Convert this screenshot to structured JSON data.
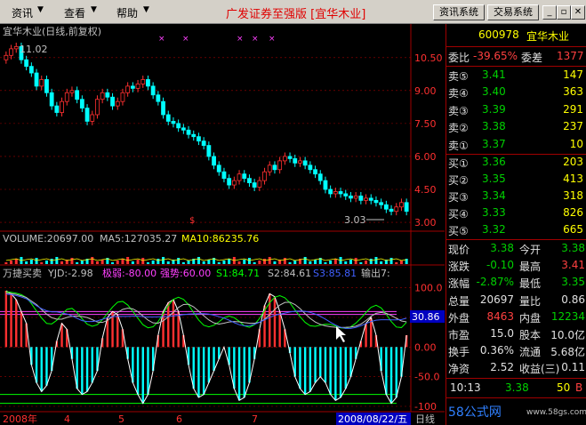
{
  "menu": {
    "items": [
      "资讯",
      "查看",
      "帮助"
    ],
    "title": "广发证券至强版 [宜华木业]",
    "buttons": [
      "资讯系统",
      "交易系统"
    ]
  },
  "chart_header": {
    "title": "宜华木业(日线,前复权)",
    "high_label": "11.02",
    "low_label": "3.03"
  },
  "chart_data": [
    {
      "type": "candlestick",
      "title": "宜华木业(日线,前复权)",
      "ylim": [
        2.8,
        11.3
      ],
      "y_ticks": [
        "10.50",
        "9.00",
        "7.50",
        "6.00",
        "4.50",
        "3.00"
      ],
      "closes": [
        10.6,
        10.9,
        11.0,
        10.4,
        10.1,
        9.8,
        9.2,
        9.5,
        8.9,
        8.3,
        8.0,
        8.5,
        8.9,
        9.0,
        8.6,
        8.2,
        7.6,
        7.9,
        8.6,
        8.9,
        8.7,
        8.3,
        8.5,
        8.9,
        9.2,
        9.1,
        9.3,
        9.5,
        9.2,
        8.8,
        8.5,
        7.9,
        7.6,
        7.5,
        7.3,
        7.2,
        7.0,
        6.9,
        6.7,
        6.5,
        6.0,
        5.6,
        5.3,
        5.0,
        4.7,
        4.9,
        5.2,
        5.0,
        4.8,
        4.6,
        4.9,
        5.3,
        5.6,
        5.4,
        5.8,
        6.0,
        5.9,
        5.7,
        5.8,
        5.6,
        5.4,
        5.2,
        4.9,
        4.5,
        4.3,
        4.4,
        4.3,
        4.2,
        4.1,
        4.2,
        4.0,
        4.1,
        4.0,
        3.9,
        3.8,
        3.6,
        3.5,
        3.7,
        3.9,
        3.5
      ],
      "x_labels": [
        "2008年",
        "4",
        "5",
        "6",
        "7",
        "2008/08/22/五"
      ]
    },
    {
      "type": "bar",
      "title": "VOLUME:20697.00",
      "legend": [
        "MA5:127035.27",
        "MA10:86235.76"
      ]
    },
    {
      "type": "line",
      "title": "万捷买卖",
      "legend": [
        "YJD:-2.98",
        "极弱:-80.00",
        "强势:60.00",
        "S1:84.71",
        "S2:84.61",
        "S3:85.81",
        "输出7:"
      ],
      "y_ticks": [
        "100.0",
        "50.00",
        "0.00",
        "-50.0",
        "-100"
      ],
      "current_value_label": "30.86",
      "ylim": [
        -100,
        110
      ],
      "histogram": [
        95,
        90,
        80,
        60,
        40,
        -30,
        -60,
        -75,
        -65,
        -40,
        10,
        40,
        30,
        -20,
        -70,
        -80,
        -75,
        -60,
        -40,
        15,
        50,
        60,
        55,
        30,
        -20,
        -60,
        -80,
        -95,
        -80,
        -40,
        20,
        60,
        75,
        80,
        60,
        20,
        -30,
        -70,
        -85,
        -80,
        -60,
        -40,
        -20,
        0,
        -30,
        -70,
        -90,
        -85,
        -60,
        -20,
        30,
        70,
        90,
        85,
        60,
        30,
        -10,
        -50,
        -70,
        -80,
        -75,
        -60,
        -50,
        -60,
        -80,
        -90,
        -85,
        -70,
        -50,
        -20,
        10,
        40,
        50,
        20,
        -40,
        -80,
        -95,
        -85,
        -50,
        20
      ]
    }
  ],
  "quote": {
    "code": "600978",
    "name": "宜华木业",
    "wei_bi_label": "委比",
    "wei_bi": "-39.65%",
    "wei_cha_label": "委差",
    "wei_cha": "1377",
    "sells": [
      {
        "label": "卖⑤",
        "price": "3.41",
        "vol": "147"
      },
      {
        "label": "卖④",
        "price": "3.40",
        "vol": "363"
      },
      {
        "label": "卖③",
        "price": "3.39",
        "vol": "291"
      },
      {
        "label": "卖②",
        "price": "3.38",
        "vol": "237"
      },
      {
        "label": "卖①",
        "price": "3.37",
        "vol": "10"
      }
    ],
    "buys": [
      {
        "label": "买①",
        "price": "3.36",
        "vol": "203"
      },
      {
        "label": "买②",
        "price": "3.35",
        "vol": "413"
      },
      {
        "label": "买③",
        "price": "3.34",
        "vol": "318"
      },
      {
        "label": "买④",
        "price": "3.33",
        "vol": "826"
      },
      {
        "label": "买⑤",
        "price": "3.32",
        "vol": "665"
      }
    ],
    "stats": [
      {
        "l1": "现价",
        "v1": "3.38",
        "l2": "今开",
        "v2": "3.38"
      },
      {
        "l1": "涨跌",
        "v1": "-0.10",
        "l2": "最高",
        "v2": "3.41"
      },
      {
        "l1": "涨幅",
        "v1": "-2.87%",
        "l2": "最低",
        "v2": "3.35"
      },
      {
        "l1": "总量",
        "v1": "20697",
        "l2": "量比",
        "v2": "0.86"
      },
      {
        "l1": "外盘",
        "v1": "8463",
        "l2": "内盘",
        "v2": "12234"
      },
      {
        "l1": "市盈",
        "v1": "15.0",
        "l2": "股本",
        "v2": "10.0亿"
      },
      {
        "l1": "换手",
        "v1": "0.36%",
        "l2": "流通",
        "v2": "5.68亿"
      },
      {
        "l1": "净资",
        "v1": "2.52",
        "l2": "收益(三)",
        "v2": "0.11"
      }
    ],
    "tick": {
      "time": "10:13",
      "price": "3.38",
      "vol": "50",
      "side": "B"
    }
  },
  "footer": {
    "tab": "日线",
    "watermark": "58公式网",
    "watermark_url": "www.58gs.com"
  },
  "colors": {
    "up": "#ff3030",
    "down": "#00ffff",
    "axis": "#a00000",
    "bg": "#000000"
  }
}
